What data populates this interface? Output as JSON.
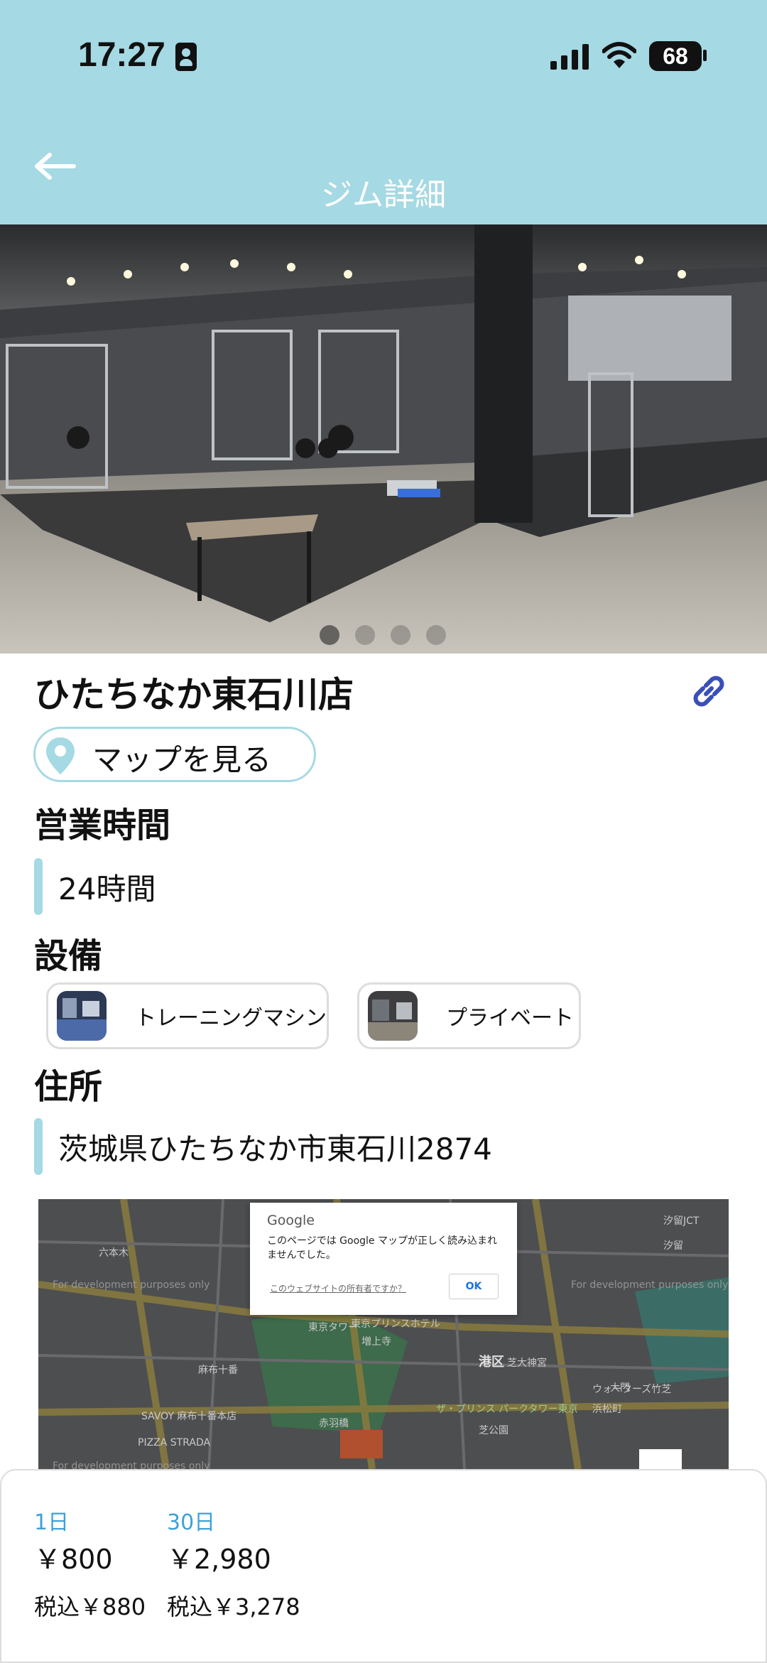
{
  "status_bar": {
    "time": "17:27",
    "battery": "68"
  },
  "header": {
    "title": "ジム詳細"
  },
  "carousel": {
    "dot_count": 4,
    "active_index": 0
  },
  "gym": {
    "name": "ひたちなか東石川店",
    "map_button_label": "マップを見る"
  },
  "sections": {
    "hours": {
      "heading": "営業時間",
      "value": "24時間"
    },
    "facilities": {
      "heading": "設備",
      "items": [
        {
          "label": "トレーニングマシン"
        },
        {
          "label": "プライベート"
        }
      ]
    },
    "address": {
      "heading": "住所",
      "value": "茨城県ひたちなか市東石川2874"
    }
  },
  "map_error": {
    "brand": "Google",
    "message": "このページでは Google マップが正しく読み込まれませんでした。",
    "owner_link": "このウェブサイトの所有者ですか？",
    "ok_label": "OK",
    "dev_text": "For development purposes only",
    "labels": [
      "六本木",
      "東京タワー",
      "増上寺",
      "港区",
      "芝大神宮",
      "麻布十番",
      "SAVOY 麻布十番本店",
      "PIZZA STRADA",
      "ザ・プリンス パークタワー東京",
      "浜松町",
      "汐留",
      "芝公園",
      "東京プリンスホテル",
      "赤羽橋",
      "大門",
      "汐留JCT",
      "ウォーターズ竹芝"
    ]
  },
  "pricing": {
    "plans": [
      {
        "period": "1日",
        "price": "￥800",
        "tax_included": "税込￥880"
      },
      {
        "period": "30日",
        "price": "￥2,980",
        "tax_included": "税込￥3,278"
      }
    ]
  },
  "colors": {
    "accent": "#a5d9e3",
    "link_blue": "#3fa2d6",
    "link_icon": "#3b4fb8"
  }
}
